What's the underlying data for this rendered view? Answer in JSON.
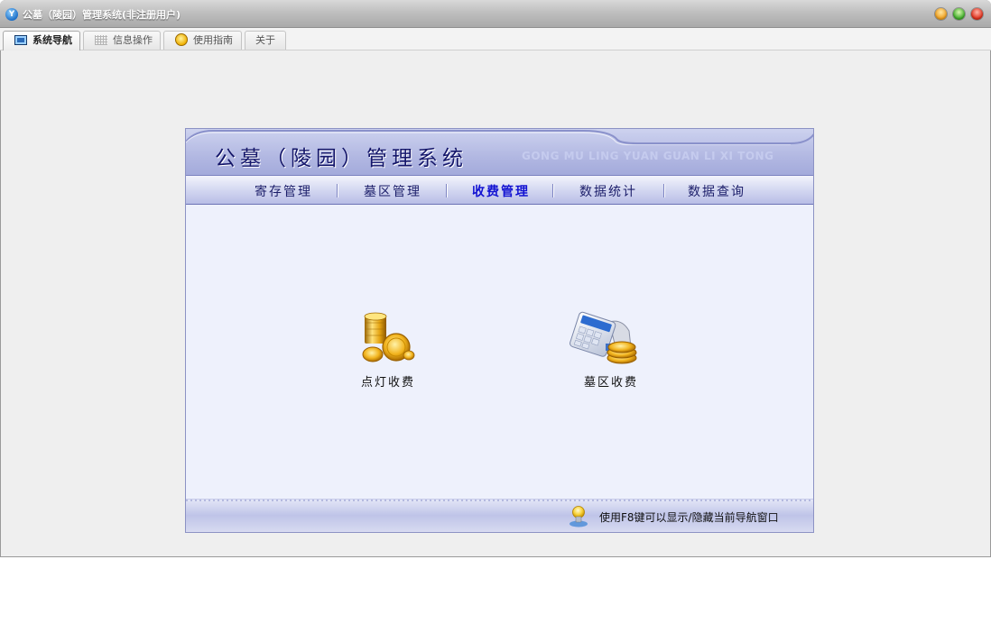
{
  "window": {
    "title": "公墓（陵园）管理系统(非注册用户)",
    "app_icon_glyph": "Y",
    "controls": [
      "minimize-icon",
      "maximize-icon",
      "close-icon"
    ]
  },
  "tabs": [
    {
      "label": "系统导航",
      "icon": "monitor-icon",
      "active": true
    },
    {
      "label": "信息操作",
      "icon": "grid-icon",
      "active": false
    },
    {
      "label": "使用指南",
      "icon": "guide-icon",
      "active": false
    },
    {
      "label": "关于",
      "icon": "",
      "active": false
    }
  ],
  "banner": {
    "title": "公墓（陵园）管理系统",
    "pinyin": "GONG MU LING YUAN GUAN LI XI TONG"
  },
  "menu": {
    "items": [
      {
        "label": "寄存管理",
        "active": false
      },
      {
        "label": "墓区管理",
        "active": false
      },
      {
        "label": "收费管理",
        "active": true
      },
      {
        "label": "数据统计",
        "active": false
      },
      {
        "label": "数据查询",
        "active": false
      }
    ]
  },
  "actions": [
    {
      "label": "点灯收费",
      "icon": "coins-icon"
    },
    {
      "label": "墓区收费",
      "icon": "calculator-coins-icon"
    }
  ],
  "footer": {
    "hint": "使用F8键可以显示/隐藏当前导航窗口",
    "icon": "lightbulb-icon"
  },
  "colors": {
    "banner_title": "#14166a",
    "menu_text": "#1c1e6a",
    "menu_active": "#1212d2",
    "panel_bg": "#eef1fb"
  }
}
